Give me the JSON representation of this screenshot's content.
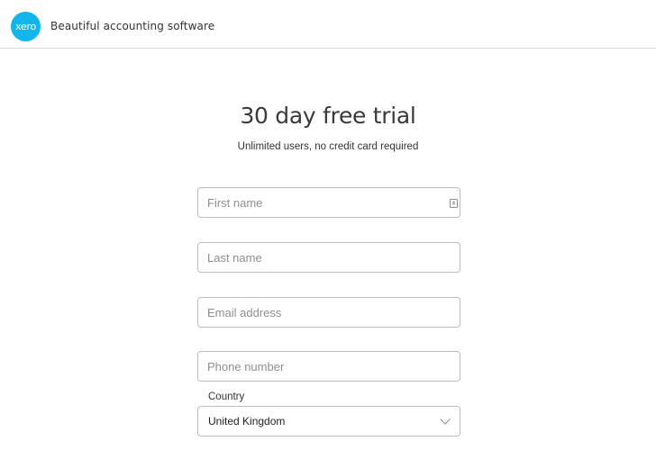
{
  "header": {
    "logo_text": "xero",
    "tagline": "Beautiful accounting software",
    "brand_color": "#13b5ea"
  },
  "main": {
    "title": "30 day free trial",
    "subtitle": "Unlimited users, no credit card required"
  },
  "form": {
    "first_name": {
      "placeholder": "First name",
      "value": "",
      "icon": "autofill-contact-card-icon"
    },
    "last_name": {
      "placeholder": "Last name",
      "value": ""
    },
    "email": {
      "placeholder": "Email address",
      "value": ""
    },
    "phone": {
      "placeholder": "Phone number",
      "value": ""
    },
    "country": {
      "label": "Country",
      "selected": "United Kingdom",
      "icon": "chevron-down-icon"
    }
  }
}
